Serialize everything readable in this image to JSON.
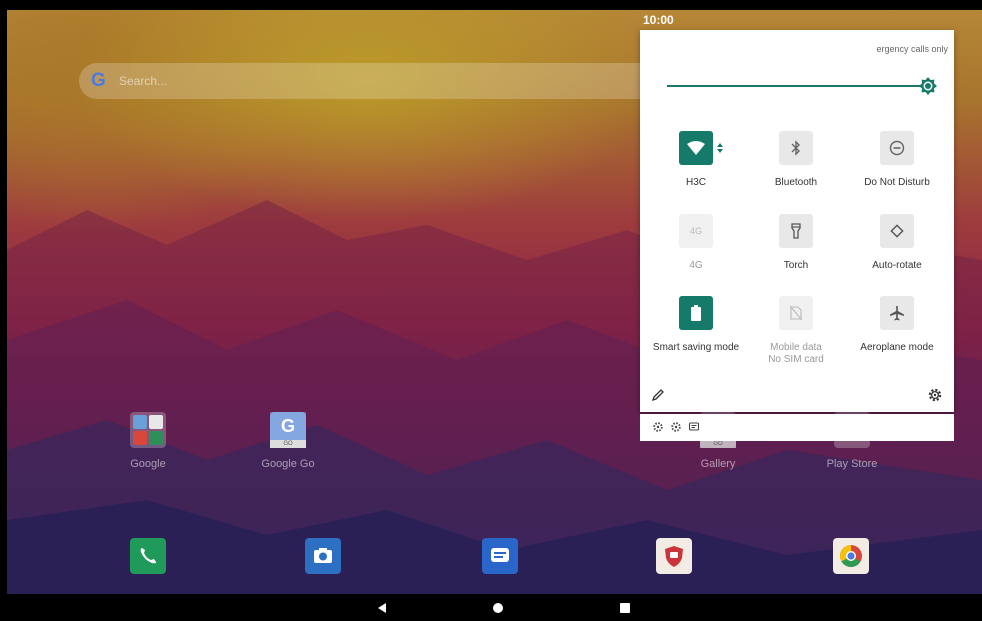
{
  "status_bar": {
    "time": "10:00"
  },
  "search": {
    "placeholder": "Search..."
  },
  "home_apps": [
    {
      "label": "Google"
    },
    {
      "label": "Google Go"
    },
    {
      "label": "Gallery"
    },
    {
      "label": "Play Store"
    }
  ],
  "quick_settings": {
    "carrier": "ergency calls only",
    "brightness_percent": 100,
    "tiles": [
      {
        "label": "H3C",
        "state": "on",
        "icon": "wifi-icon"
      },
      {
        "label": "Bluetooth",
        "state": "off",
        "icon": "bluetooth-icon"
      },
      {
        "label": "Do Not Disturb",
        "state": "off",
        "icon": "dnd-icon"
      },
      {
        "label": "4G",
        "state": "unavailable",
        "icon": "4g-icon",
        "icon_text": "4G"
      },
      {
        "label": "Torch",
        "state": "off",
        "icon": "torch-icon"
      },
      {
        "label": "Auto-rotate",
        "state": "off",
        "icon": "auto-rotate-icon"
      },
      {
        "label": "Smart saving mode",
        "state": "on",
        "icon": "battery-icon"
      },
      {
        "label": "Mobile data",
        "sublabel": "No SIM card",
        "state": "unavailable",
        "icon": "no-sim-icon"
      },
      {
        "label": "Aeroplane mode",
        "state": "off",
        "icon": "airplane-icon"
      }
    ],
    "colors": {
      "accent": "#167a6a",
      "inactive_tile": "#e8e8e8"
    }
  },
  "google_go_icon_text": "GO",
  "google_go_letter": "G",
  "gallery_icon_text": "GO"
}
